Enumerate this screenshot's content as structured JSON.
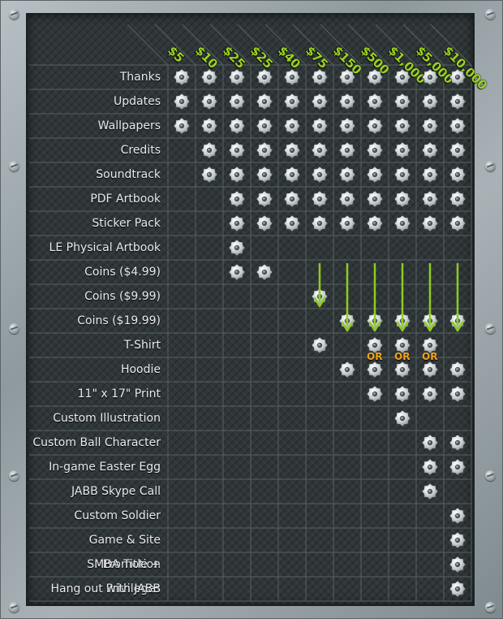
{
  "columns": [
    "$5",
    "$10",
    "$25",
    "$25",
    "$40",
    "$75",
    "$150",
    "$500",
    "$1,000",
    "$5,000",
    "$10,000"
  ],
  "rows": [
    {
      "label": "Thanks",
      "cells": [
        1,
        1,
        1,
        1,
        1,
        1,
        1,
        1,
        1,
        1,
        1
      ]
    },
    {
      "label": "Updates",
      "cells": [
        1,
        1,
        1,
        1,
        1,
        1,
        1,
        1,
        1,
        1,
        1
      ]
    },
    {
      "label": "Wallpapers",
      "cells": [
        1,
        1,
        1,
        1,
        1,
        1,
        1,
        1,
        1,
        1,
        1
      ]
    },
    {
      "label": "Credits",
      "cells": [
        0,
        1,
        1,
        1,
        1,
        1,
        1,
        1,
        1,
        1,
        1
      ]
    },
    {
      "label": "Soundtrack",
      "cells": [
        0,
        1,
        1,
        1,
        1,
        1,
        1,
        1,
        1,
        1,
        1
      ]
    },
    {
      "label": "PDF Artbook",
      "cells": [
        0,
        0,
        1,
        1,
        1,
        1,
        1,
        1,
        1,
        1,
        1
      ]
    },
    {
      "label": "Sticker Pack",
      "cells": [
        0,
        0,
        1,
        1,
        1,
        1,
        1,
        1,
        1,
        1,
        1
      ]
    },
    {
      "label": "LE Physical Artbook",
      "cells": [
        0,
        0,
        1,
        0,
        0,
        0,
        0,
        0,
        0,
        0,
        0
      ]
    },
    {
      "label": "Coins ($4.99)",
      "cells": [
        0,
        0,
        1,
        1,
        0,
        0,
        0,
        0,
        0,
        0,
        0
      ]
    },
    {
      "label": "Coins ($9.99)",
      "cells": [
        0,
        0,
        0,
        0,
        0,
        1,
        0,
        0,
        0,
        0,
        0
      ]
    },
    {
      "label": "Coins ($19.99)",
      "cells": [
        0,
        0,
        0,
        0,
        0,
        0,
        1,
        1,
        1,
        1,
        1
      ]
    },
    {
      "label": "T-Shirt",
      "cells": [
        0,
        0,
        0,
        0,
        0,
        1,
        0,
        1,
        1,
        1,
        0
      ]
    },
    {
      "label": "Hoodie",
      "cells": [
        0,
        0,
        0,
        0,
        0,
        0,
        1,
        1,
        1,
        1,
        1
      ]
    },
    {
      "label": "11\" x 17\" Print",
      "cells": [
        0,
        0,
        0,
        0,
        0,
        0,
        0,
        1,
        1,
        1,
        1
      ]
    },
    {
      "label": "Custom Illustration",
      "cells": [
        0,
        0,
        0,
        0,
        0,
        0,
        0,
        0,
        1,
        0,
        0
      ]
    },
    {
      "label": "Custom Ball Character",
      "cells": [
        0,
        0,
        0,
        0,
        0,
        0,
        0,
        0,
        0,
        1,
        1
      ]
    },
    {
      "label": "In-game Easter Egg",
      "cells": [
        0,
        0,
        0,
        0,
        0,
        0,
        0,
        0,
        0,
        1,
        1
      ]
    },
    {
      "label": "JABB Skype Call",
      "cells": [
        0,
        0,
        0,
        0,
        0,
        0,
        0,
        0,
        0,
        1,
        0
      ]
    },
    {
      "label": "Custom Soldier",
      "cells": [
        0,
        0,
        0,
        0,
        0,
        0,
        0,
        0,
        0,
        0,
        1
      ]
    },
    {
      "label": "Game & Site Promotion",
      "cells": [
        0,
        0,
        0,
        0,
        0,
        0,
        0,
        0,
        0,
        0,
        1
      ]
    },
    {
      "label": "SMBA Title + Privileges",
      "cells": [
        0,
        0,
        0,
        0,
        0,
        0,
        0,
        0,
        0,
        0,
        1
      ]
    },
    {
      "label": "Hang out with JABB",
      "cells": [
        0,
        0,
        0,
        0,
        0,
        0,
        0,
        0,
        0,
        0,
        1
      ]
    }
  ],
  "arrows": [
    {
      "col": 5,
      "from_row": 8,
      "to_row": 9
    },
    {
      "col": 6,
      "from_row": 8,
      "to_row": 10
    },
    {
      "col": 7,
      "from_row": 8,
      "to_row": 10
    },
    {
      "col": 8,
      "from_row": 8,
      "to_row": 10
    },
    {
      "col": 9,
      "from_row": 8,
      "to_row": 10
    },
    {
      "col": 10,
      "from_row": 8,
      "to_row": 10
    }
  ],
  "or_markers": [
    {
      "col": 7,
      "row": 11,
      "text": "OR"
    },
    {
      "col": 8,
      "row": 11,
      "text": "OR"
    },
    {
      "col": 9,
      "row": 11,
      "text": "OR"
    }
  ],
  "colors": {
    "price": "#9ad321",
    "arrow": "#8fcb1e",
    "or": "#f4a416",
    "grid": "#566064"
  }
}
